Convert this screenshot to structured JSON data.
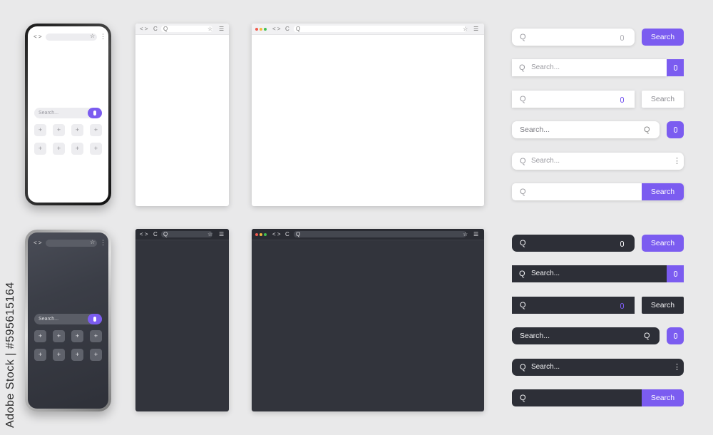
{
  "colors": {
    "accent": "#7b5cf0",
    "dark_surface": "#2d2f37",
    "light_surface": "#ffffff",
    "background": "#e9e9ea"
  },
  "phone": {
    "nav_glyph": "< >",
    "star_glyph": "☆",
    "menu_glyph": "⋮",
    "search_placeholder": "Search...",
    "tile_glyph": "+"
  },
  "browser": {
    "back_forward": "< >",
    "reload": "C",
    "search_glyph": "Q",
    "star": "☆",
    "menu": "☰"
  },
  "search_bars": {
    "search_label": "Search",
    "placeholder": "Search...",
    "menu_glyph": "⋮",
    "search_glyph": "Q"
  },
  "side_text": "Adobe Stock | #595615164"
}
